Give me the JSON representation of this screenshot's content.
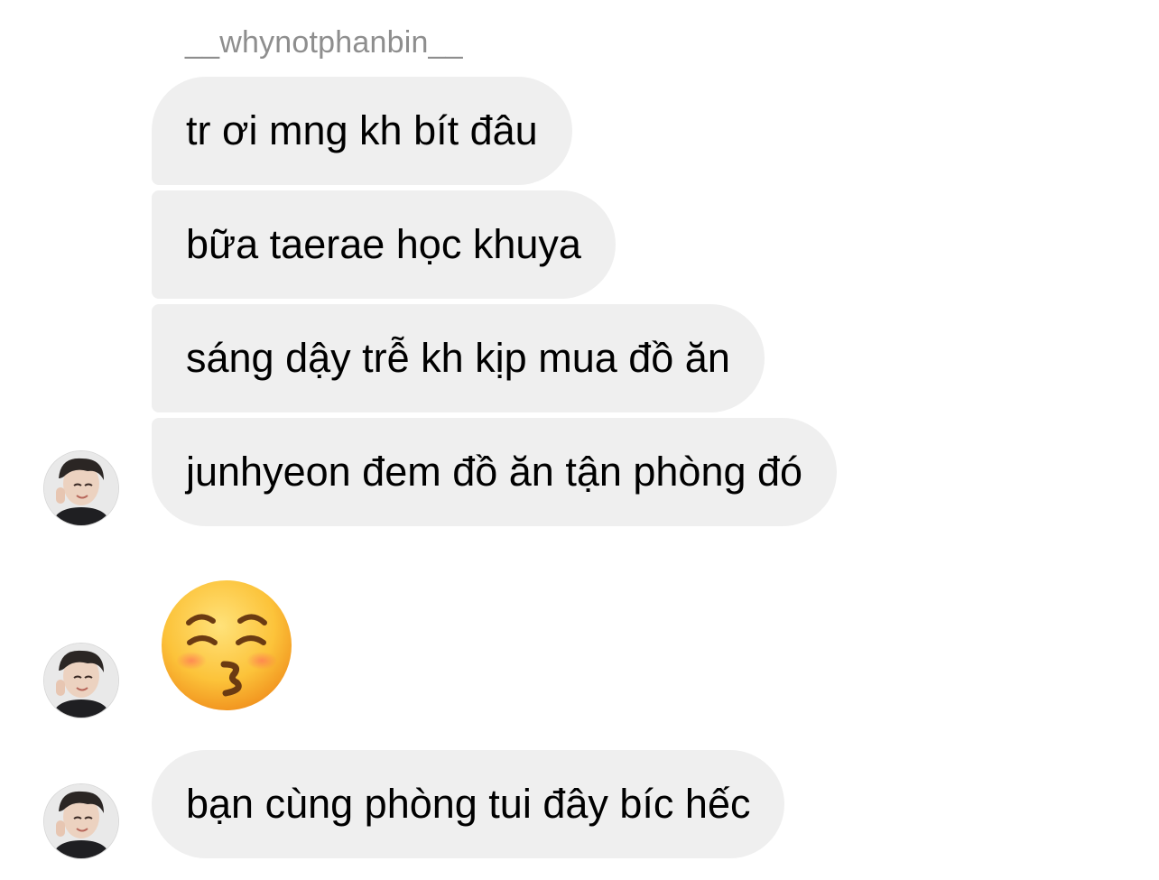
{
  "thread": {
    "sender_name": "__whynotphanbin__",
    "messages": [
      {
        "type": "text",
        "text": "tr ơi mng kh bít đâu"
      },
      {
        "type": "text",
        "text": "bữa taerae học khuya"
      },
      {
        "type": "text",
        "text": "sáng dậy trễ kh kịp mua đồ ăn"
      },
      {
        "type": "text",
        "text": "junhyeon đem đồ ăn tận phòng đó"
      },
      {
        "type": "emoji",
        "icon": "kissing-face-with-closed-eyes-icon"
      },
      {
        "type": "text",
        "text": "bạn cùng phòng tui đây bíc hếc"
      }
    ]
  },
  "colors": {
    "bubble_bg": "#efefef",
    "sender_text": "#8e8e8e",
    "message_text": "#000000"
  }
}
